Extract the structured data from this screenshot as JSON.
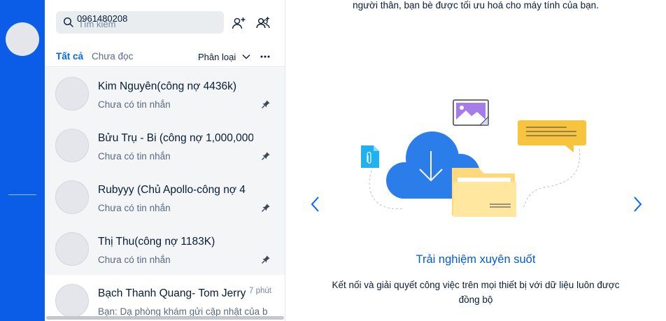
{
  "search": {
    "value": "0961480208",
    "placeholder": "Tìm kiếm"
  },
  "filters": {
    "all_label": "Tất cả",
    "unread_label": "Chưa đọc",
    "classify_label": "Phân loại"
  },
  "conversations": [
    {
      "name": "Kim Nguyên(công nợ 4436k)",
      "preview": "Chưa có tin nhắn",
      "pinned": true
    },
    {
      "name": "Bửu Trụ - Bi (công nợ 1,000,000",
      "preview": "Chưa có tin nhắn",
      "pinned": true
    },
    {
      "name": "Rubyyy (Chủ Apollo-công nợ 4",
      "preview": "Chưa có tin nhắn",
      "pinned": true
    },
    {
      "name": "Thị Thu(công nợ 1183K)",
      "preview": "Chưa có tin nhắn",
      "pinned": true
    },
    {
      "name": "Bạch Thanh Quang- Tom Jerry",
      "preview": "Bạn: Dạ phòng khám gửi cập nhật của b",
      "time": "7 phút",
      "pinned": false
    }
  ],
  "onboarding": {
    "top_text": "người thân, bạn bè được tối ưu hoá cho máy tính của bạn.",
    "title": "Trải nghiệm xuyên suốt",
    "description": "Kết nối và giải quyết công việc trên mọi thiết bị với dữ liệu luôn được đồng bộ"
  },
  "colors": {
    "nav_blue": "#0b5ce6",
    "accent": "#0068ff",
    "title_blue": "#005ae0"
  },
  "icons": {
    "search": "search-icon",
    "add_friend": "add-friend-icon",
    "create_group": "create-group-icon",
    "pin": "pin-icon",
    "prev": "chevron-left-icon",
    "next": "chevron-right-icon"
  }
}
